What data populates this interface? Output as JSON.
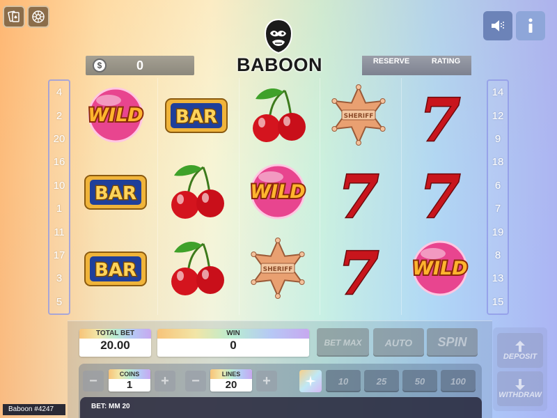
{
  "brand": {
    "name": "BABOON"
  },
  "balance": {
    "currency_symbol": "$",
    "amount": "0"
  },
  "tabs": [
    "RESERVE",
    "RATING"
  ],
  "left_lines": [
    "4",
    "2",
    "20",
    "16",
    "10",
    "1",
    "11",
    "17",
    "3",
    "5"
  ],
  "right_lines": [
    "14",
    "12",
    "9",
    "18",
    "6",
    "7",
    "19",
    "8",
    "13",
    "15"
  ],
  "reels": [
    [
      "WILD",
      "BAR",
      "BAR"
    ],
    [
      "BAR",
      "CHERRY",
      "CHERRY"
    ],
    [
      "CHERRY",
      "WILD",
      "SHERIFF"
    ],
    [
      "SHERIFF",
      "SEVEN",
      "SEVEN"
    ],
    [
      "SEVEN",
      "SEVEN",
      "WILD"
    ]
  ],
  "symbol_text": {
    "wild": "WILD",
    "bar": "BAR",
    "seven": "7",
    "sheriff": "SHERIFF"
  },
  "total_bet": {
    "label": "TOTAL BET",
    "value": "20.00"
  },
  "win": {
    "label": "WIN",
    "value": "0"
  },
  "buttons": {
    "bet_max": "BET MAX",
    "auto": "AUTO",
    "spin": "SPIN",
    "deposit": "DEPOSIT",
    "withdraw": "WITHDRAW"
  },
  "coins": {
    "label": "COINS",
    "value": "1"
  },
  "lines": {
    "label": "LINES",
    "value": "20"
  },
  "bet_options": [
    "10",
    "25",
    "50",
    "100"
  ],
  "bet_info": "BET: MM 20",
  "player_id": "Baboon #4247",
  "icons": [
    "cards-icon",
    "roulette-icon",
    "sound-icon",
    "info-icon",
    "dollar-coin-icon",
    "gorilla-logo-icon",
    "sparkle-icon",
    "arrow-up-icon",
    "arrow-down-icon"
  ]
}
